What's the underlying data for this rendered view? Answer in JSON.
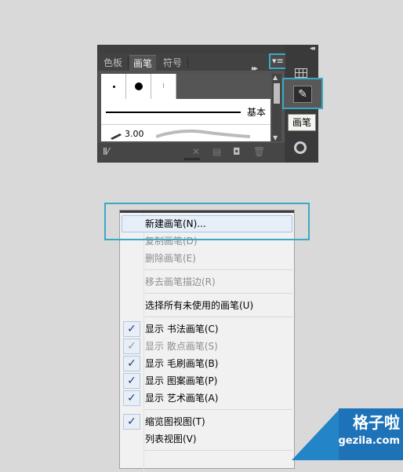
{
  "panel": {
    "tabs": [
      "色板",
      "画笔",
      "符号"
    ],
    "active_tab": "画笔",
    "menu_icon": "panel-menu-icon",
    "forward_icon": "▸▸",
    "brushes": {
      "basic_label": "基本",
      "size_label": "3.00"
    },
    "bottom_icons": [
      "brush-library-icon",
      "remove-stroke-icon",
      "options-icon",
      "new-brush-icon",
      "delete-icon"
    ]
  },
  "dock": {
    "collapse_icon": "◂◂",
    "tooltip": "画笔"
  },
  "menu": {
    "items": [
      {
        "label": "新建画笔(N)...",
        "enabled": true,
        "checked": false
      },
      {
        "label": "复制画笔(D)",
        "enabled": false,
        "checked": false
      },
      {
        "label": "删除画笔(E)",
        "enabled": false,
        "checked": false
      },
      {
        "label": "移去画笔描边(R)",
        "enabled": false,
        "checked": false
      },
      {
        "label": "选择所有未使用的画笔(U)",
        "enabled": true,
        "checked": false
      },
      {
        "label": "显示 书法画笔(C)",
        "enabled": true,
        "checked": true
      },
      {
        "label": "显示 散点画笔(S)",
        "enabled": false,
        "checked": true
      },
      {
        "label": "显示 毛刷画笔(B)",
        "enabled": true,
        "checked": true
      },
      {
        "label": "显示 图案画笔(P)",
        "enabled": true,
        "checked": true
      },
      {
        "label": "显示 艺术画笔(A)",
        "enabled": true,
        "checked": true
      },
      {
        "label": "缩览图视图(T)",
        "enabled": true,
        "checked": true
      },
      {
        "label": "列表视图(V)",
        "enabled": true,
        "checked": false
      }
    ]
  },
  "watermark": {
    "name": "格子啦",
    "url": "gezila.com"
  },
  "colors": {
    "highlight": "#3aa9c4",
    "panel_bg": "#535353",
    "menu_bg": "#f1f1f1"
  }
}
